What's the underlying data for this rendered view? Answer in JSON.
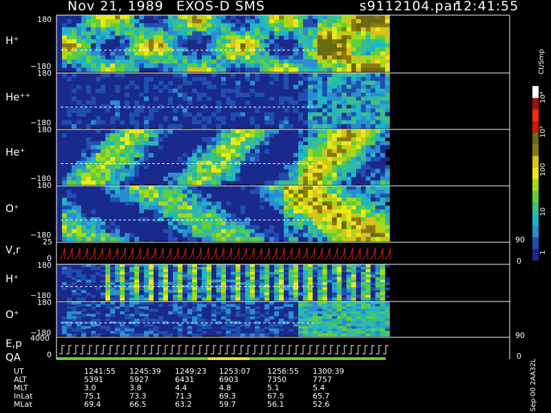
{
  "header": {
    "date": "Nov 21, 1989",
    "mission": "EXOS-D SMS",
    "file": "s9112104.par",
    "time": "12:41:55"
  },
  "colorbar": {
    "unit_label": "Ct/Smp",
    "tick_labels": [
      "10⁴",
      "10³",
      "100",
      "10",
      "1"
    ],
    "colors": [
      "#1a2a8c",
      "#1f4fb0",
      "#2a8fd0",
      "#1fb6c4",
      "#3bbf8a",
      "#5fcf3a",
      "#a6d81a",
      "#e8e81a",
      "#d9c21a",
      "#8a7a10",
      "#6a6a14",
      "#c81a0a",
      "#ff2a10",
      "#a01010",
      "#ffffff"
    ]
  },
  "panels": [
    {
      "id": "h-plus",
      "label": "H⁺",
      "ytop": "180",
      "ybot": "−180"
    },
    {
      "id": "he-plus-plus",
      "label": "He⁺⁺",
      "ytop": "180",
      "ybot": "−180"
    },
    {
      "id": "he-plus",
      "label": "He⁺",
      "ytop": "180",
      "ybot": "−180"
    },
    {
      "id": "o-plus",
      "label": "O⁺",
      "ytop": "180",
      "ybot": "−180"
    },
    {
      "id": "vr",
      "label": "V,r",
      "ytop": "25",
      "ybot": "0",
      "right_top": "90",
      "right_bot": "0"
    },
    {
      "id": "h-plus-2",
      "label": "H⁺",
      "ytop": "180",
      "ybot": "−180"
    },
    {
      "id": "o-plus-2",
      "label": "O⁺",
      "ytop": "180",
      "ybot": "−180"
    },
    {
      "id": "ep",
      "label": "E,p",
      "label2": "QA",
      "ytop": "4000",
      "ybot": "0",
      "right_top": "90",
      "right_bot": "0"
    }
  ],
  "footer": {
    "rows": [
      {
        "name": "UT",
        "values": [
          "1241:55",
          "1245:39",
          "1249:23",
          "1253:07",
          "1256:55",
          "1300:39"
        ]
      },
      {
        "name": "ALT",
        "values": [
          "5391",
          "5927",
          "6431",
          "6903",
          "7350",
          "7757"
        ]
      },
      {
        "name": "MLT",
        "values": [
          "3.0",
          "3.8",
          "4.4",
          "4.8",
          "5.1",
          "5.4"
        ]
      },
      {
        "name": "InLat",
        "values": [
          "75.1",
          "73.3",
          "71.3",
          "69.3",
          "67.5",
          "65.7"
        ]
      },
      {
        "name": "MLat",
        "values": [
          "69.4",
          "66.5",
          "63.2",
          "59.7",
          "56.1",
          "52.6"
        ]
      }
    ],
    "version": "Sep-00 2AA32L"
  },
  "chart_data": {
    "type": "heatmap",
    "title": "Nov 21, 1989   EXOS-D SMS",
    "xlabel": "UT",
    "x_tick_labels": [
      "1241:55",
      "1245:39",
      "1249:23",
      "1253:07",
      "1256:55",
      "1300:39"
    ],
    "colorbar_label": "Ct/Smp",
    "color_scale": "log",
    "color_range": [
      1,
      10000
    ],
    "panels": [
      {
        "name": "H+",
        "ylim": [
          -180,
          180
        ]
      },
      {
        "name": "He++",
        "ylim": [
          -180,
          180
        ]
      },
      {
        "name": "He+",
        "ylim": [
          -180,
          180
        ]
      },
      {
        "name": "O+",
        "ylim": [
          -180,
          180
        ]
      },
      {
        "name": "V,r",
        "ylim": [
          0,
          25
        ],
        "right_ylim": [
          0,
          90
        ]
      },
      {
        "name": "H+",
        "ylim": [
          -180,
          180
        ]
      },
      {
        "name": "O+",
        "ylim": [
          -180,
          180
        ]
      },
      {
        "name": "E,p / QA",
        "ylim": [
          0,
          4000
        ],
        "right_ylim": [
          0,
          90
        ]
      }
    ]
  }
}
